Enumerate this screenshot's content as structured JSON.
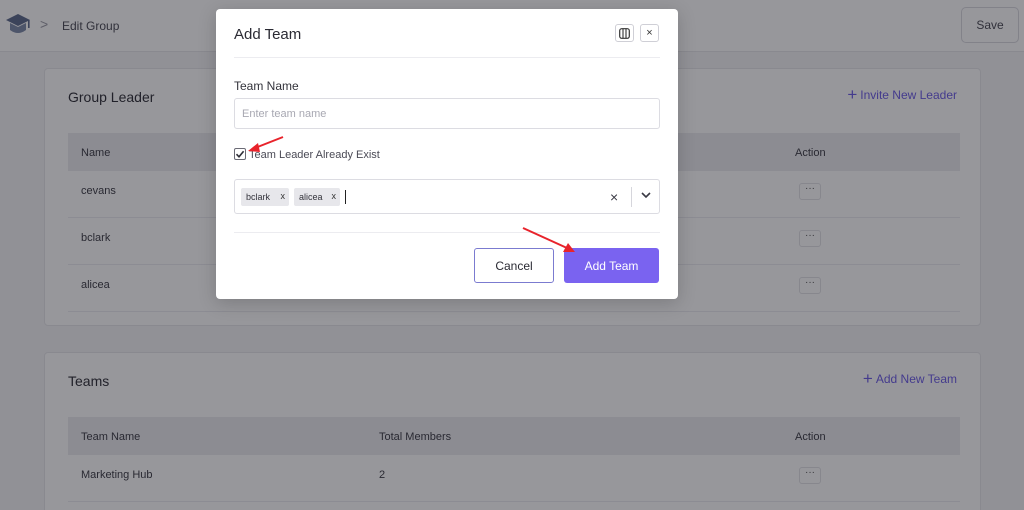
{
  "header": {
    "breadcrumb_separator": ">",
    "page_title": "Edit Group",
    "save_label": "Save"
  },
  "group_leader": {
    "title": "Group Leader",
    "invite_label": "Invite New Leader",
    "columns": [
      "Name",
      "Action"
    ],
    "rows": [
      {
        "name": "cevans",
        "action": "···"
      },
      {
        "name": "bclark",
        "action": "···"
      },
      {
        "name": "alicea",
        "action": "···"
      }
    ]
  },
  "teams": {
    "title": "Teams",
    "add_label": "Add New Team",
    "columns": [
      "Team Name",
      "Total Members",
      "Action"
    ],
    "rows": [
      {
        "team_name": "Marketing Hub",
        "total_members": "2",
        "action": "···"
      }
    ]
  },
  "modal": {
    "title": "Add Team",
    "team_name_label": "Team Name",
    "team_name_placeholder": "Enter team name",
    "team_name_value": "",
    "leader_exists_label": "Team Leader Already Exist",
    "leader_exists_checked": true,
    "selected_leaders": [
      {
        "label": "bclark",
        "remove": "x"
      },
      {
        "label": "alicea",
        "remove": "x"
      }
    ],
    "clear_glyph": "×",
    "close_glyph": "×",
    "cancel_label": "Cancel",
    "submit_label": "Add Team"
  },
  "colors": {
    "accent": "#7a63f0",
    "link": "#6c5ce7",
    "annotation_arrow": "#e8232b",
    "overlay": "#12121c"
  },
  "icons": [
    "logo-icon",
    "chevron-right-icon",
    "plus-icon",
    "split-view-icon",
    "close-icon",
    "check-icon",
    "clear-icon",
    "chevron-down-icon"
  ]
}
